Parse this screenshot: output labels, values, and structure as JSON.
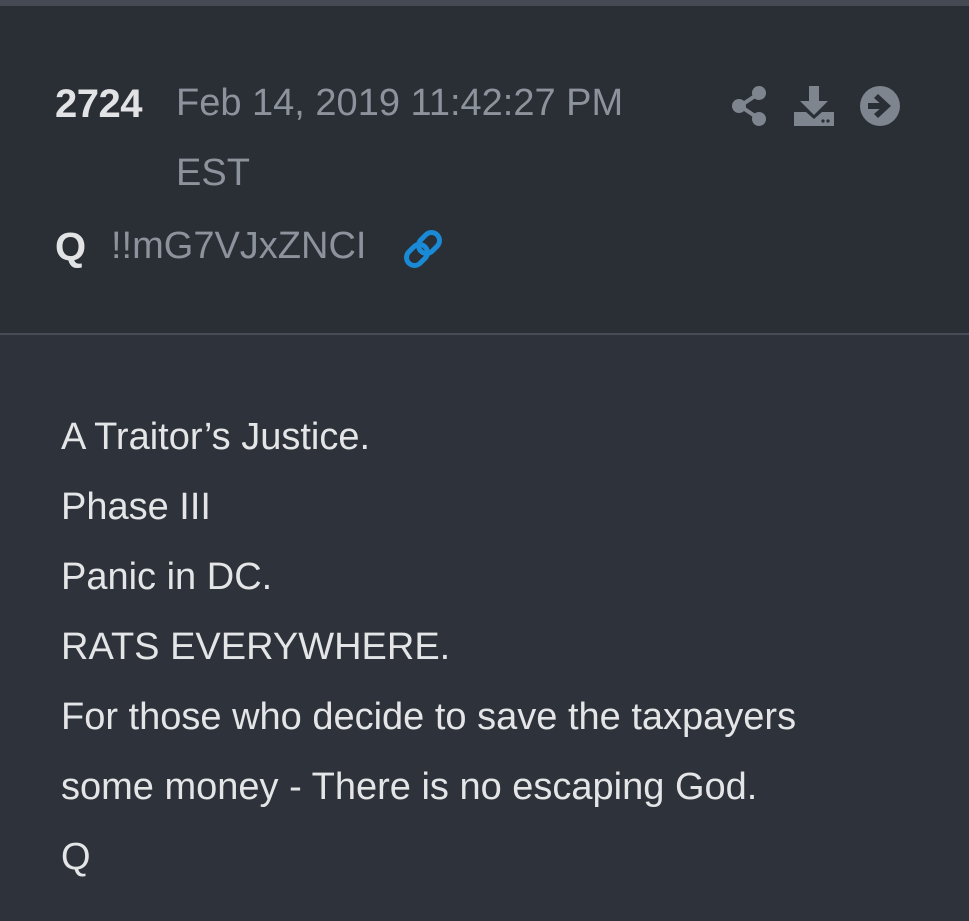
{
  "post": {
    "number": "2724",
    "date": "Feb 14, 2019 11:42:27 PM EST",
    "author": "Q",
    "tripcode": "!!mG7VJxZNCI"
  },
  "actions": {
    "share_icon": "share-icon",
    "download_icon": "download-icon",
    "next_icon": "arrow-circle-right-icon",
    "link_icon": "link-icon"
  },
  "body": {
    "lines": [
      "A Traitor’s Justice.",
      "Phase III",
      "Panic in DC.",
      "RATS EVERYWHERE.",
      "For those who decide to save the taxpayers",
      "some money - There is no escaping God.",
      "Q"
    ]
  },
  "colors": {
    "background": "#2e323a",
    "header_background": "#2a2e35",
    "text": "#e4e5e7",
    "muted_text": "#8d939c",
    "icon": "#7f858e",
    "link_accent": "#1a8ad6"
  }
}
